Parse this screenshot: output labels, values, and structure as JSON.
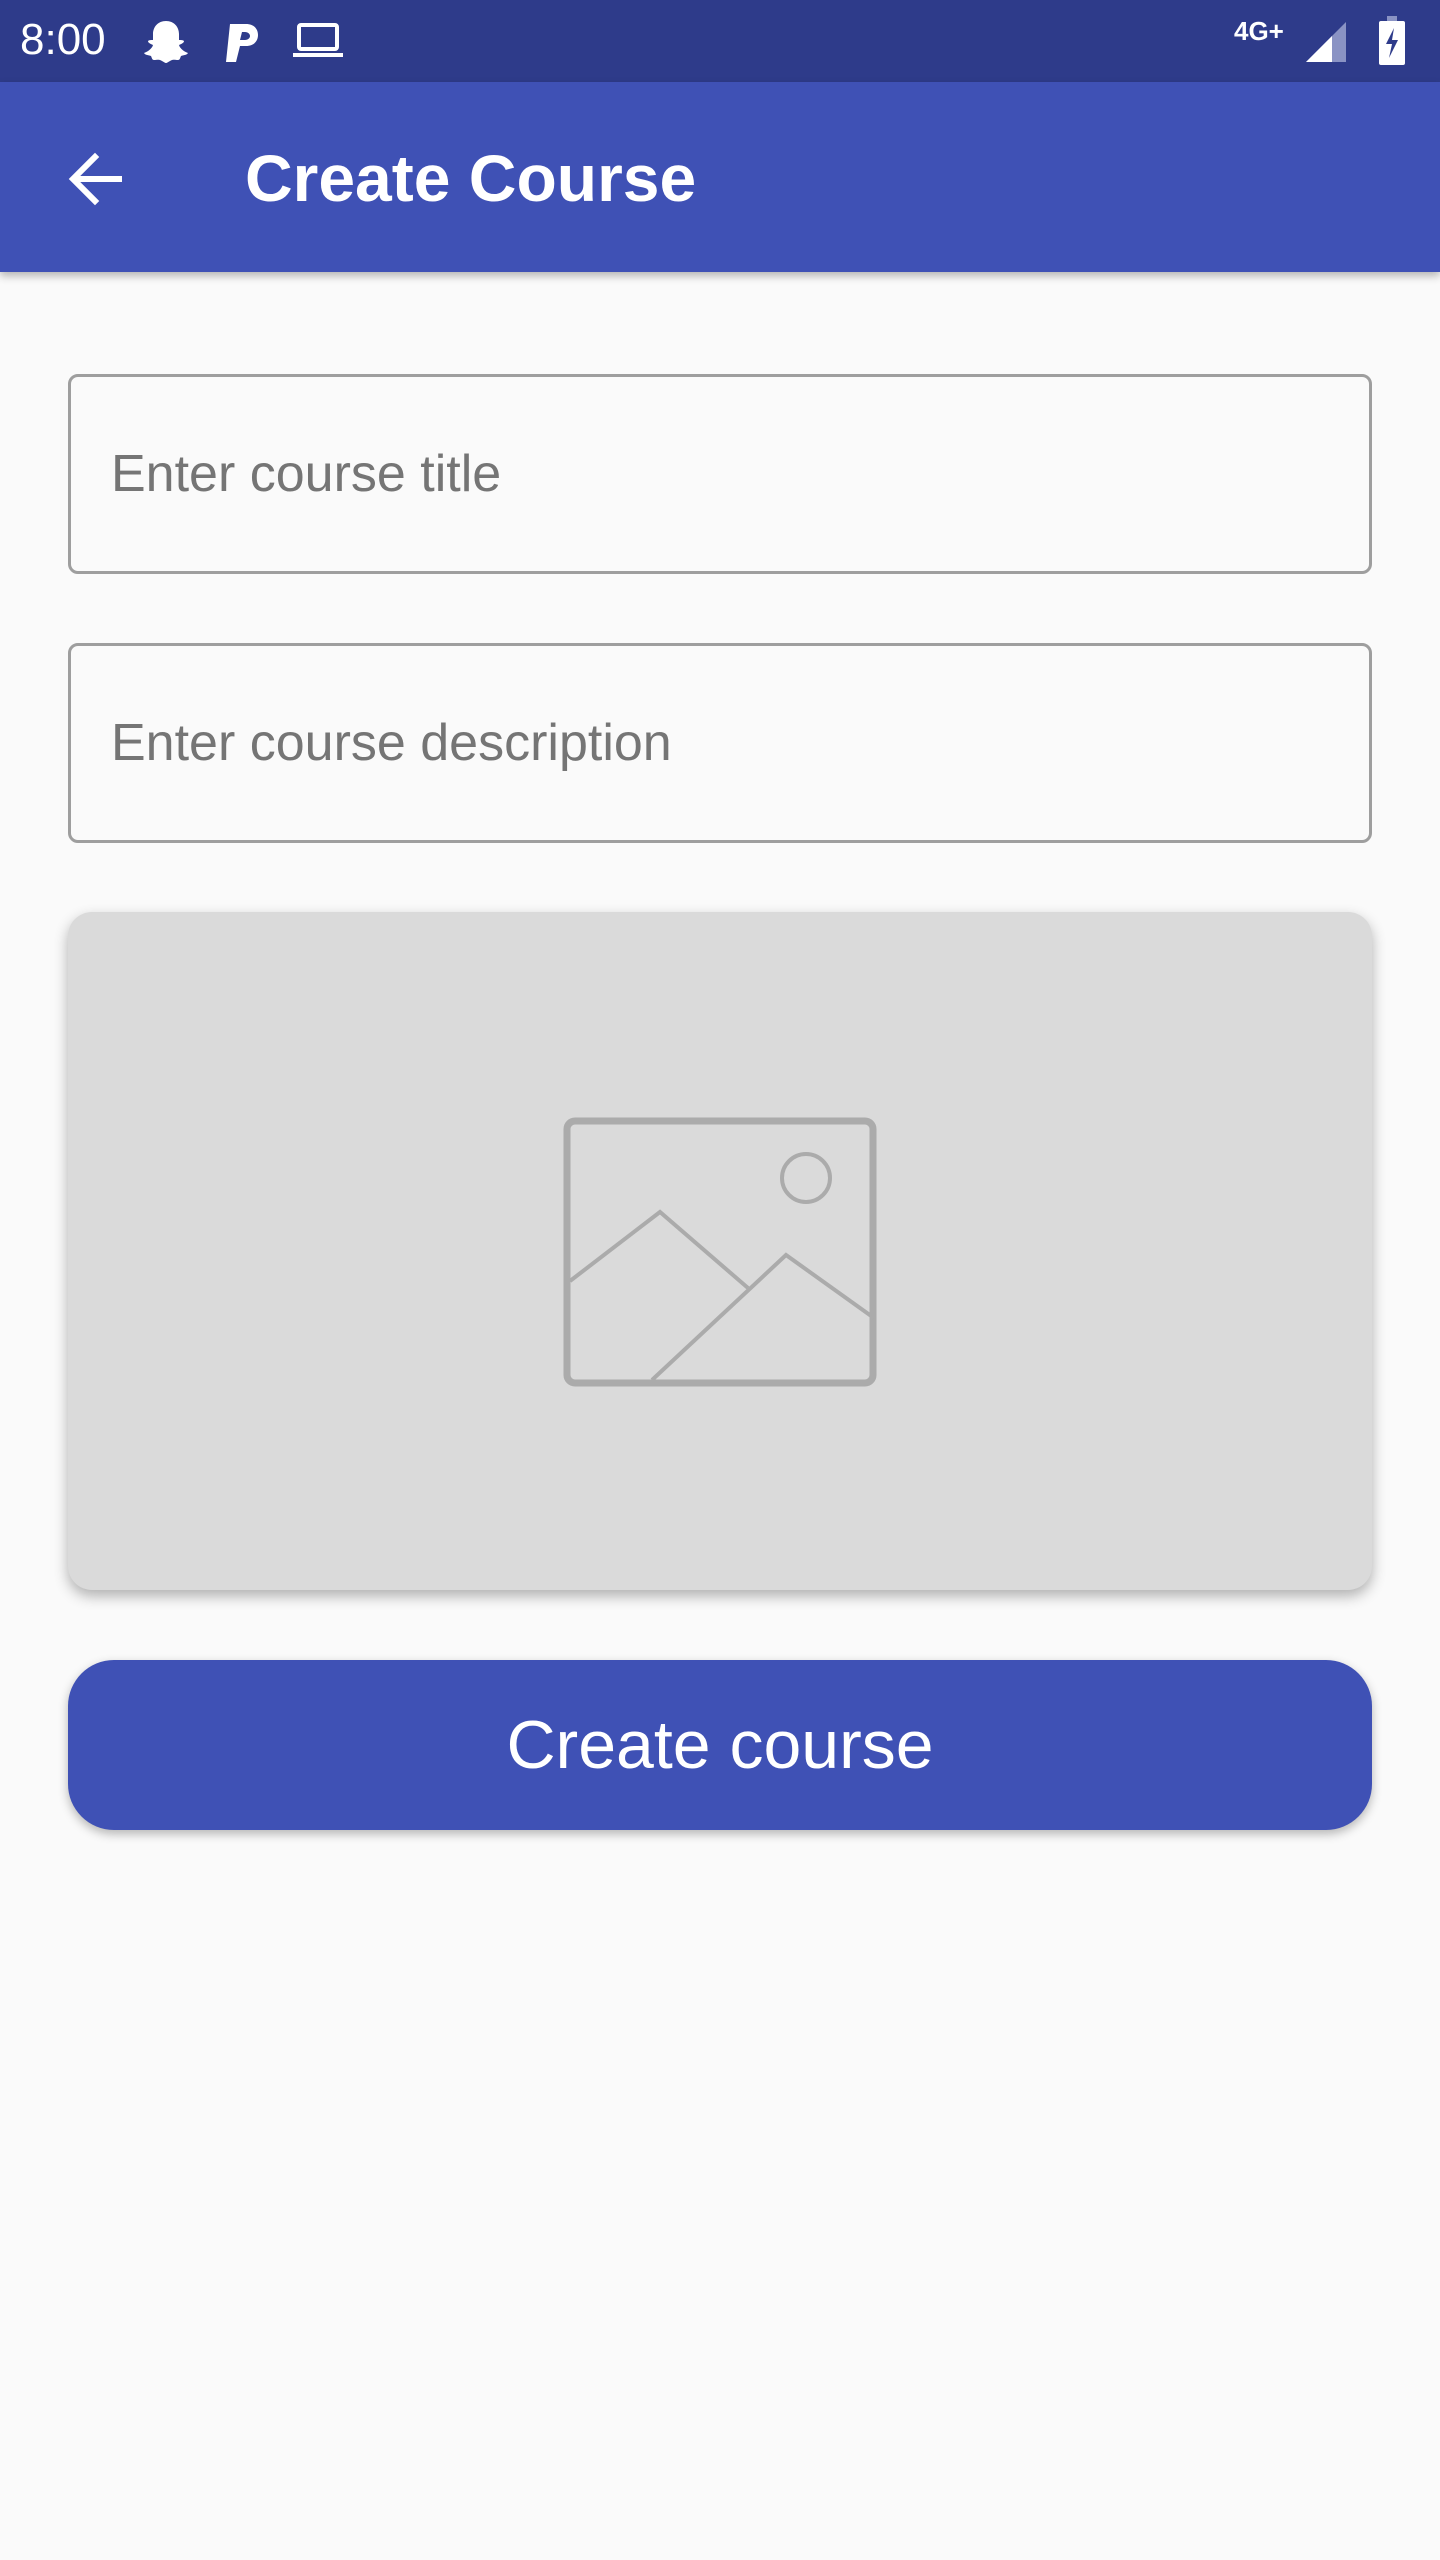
{
  "status_bar": {
    "time": "8:00",
    "network": "4G+",
    "icons": [
      "snapchat-icon",
      "parking-icon",
      "laptop-icon",
      "signal-icon",
      "battery-charging-icon"
    ]
  },
  "app_bar": {
    "title": "Create Course",
    "back_icon": "arrow-back-icon",
    "color": "#3f51b5"
  },
  "form": {
    "title_placeholder": "Enter course title",
    "title_value": "",
    "description_placeholder": "Enter course description",
    "description_value": "",
    "image_icon": "image-placeholder-icon",
    "submit_label": "Create course"
  },
  "colors": {
    "status_bar": "#2e3b8a",
    "primary": "#3f51b5",
    "background": "#fafafa",
    "image_card": "#dadada"
  }
}
